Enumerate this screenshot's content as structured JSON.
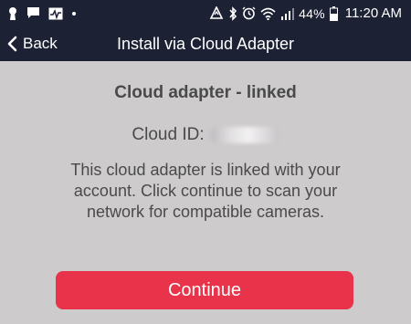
{
  "status_bar": {
    "battery_percent": "44%",
    "time": "11:20 AM",
    "left_icons": [
      "keyhole-icon",
      "chat-bubble-icon",
      "activity-icon",
      "dot-icon"
    ],
    "right_icons": [
      "recycle-icon",
      "bluetooth-icon",
      "alarm-icon",
      "wifi-icon",
      "signal-icon",
      "battery-icon"
    ]
  },
  "nav": {
    "back_label": "Back",
    "title": "Install via Cloud Adapter"
  },
  "main": {
    "heading": "Cloud adapter - linked",
    "cloud_id_label": "Cloud ID:",
    "description": "This cloud adapter is linked with your account. Click continue to scan your network for compatible cameras.",
    "continue_label": "Continue"
  },
  "colors": {
    "header_bg": "#1c2134",
    "page_bg": "#cdcbcc",
    "button_bg": "#e8334a",
    "text": "#4a4a4a"
  }
}
